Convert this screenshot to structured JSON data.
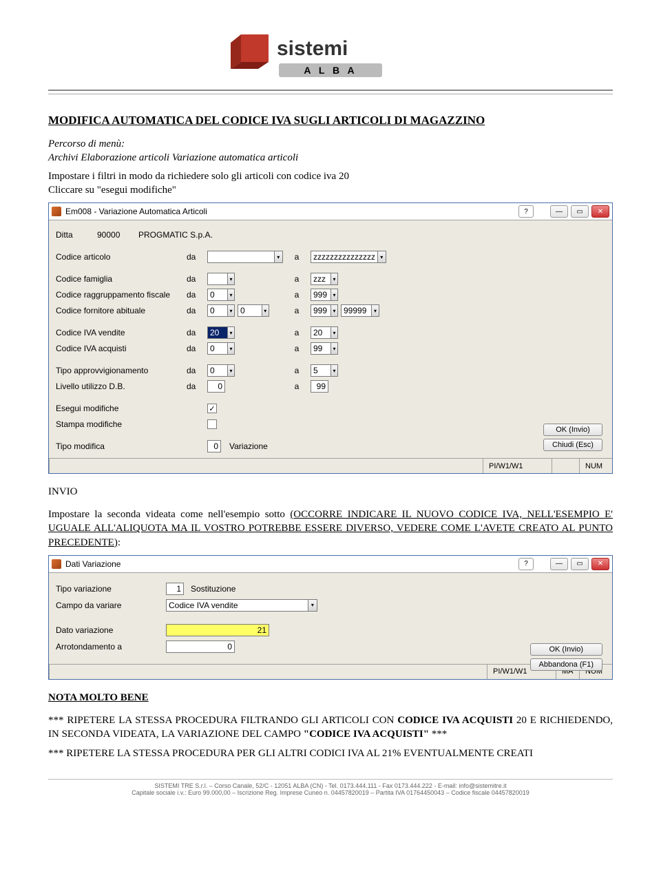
{
  "logo": {
    "brand_top": "sistemi",
    "brand_bottom": "A L B A"
  },
  "title": "MODIFICA AUTOMATICA DEL CODICE IVA SUGLI ARTICOLI DI MAGAZZINO",
  "intro": {
    "percorso_label": "Percorso di menù:",
    "percorso_path": "Archivi Elaborazione articoli Variazione automatica articoli",
    "step1": "Impostare i filtri in modo da richiedere solo gli articoli con codice iva 20",
    "step2": "Cliccare su \"esegui modifiche\""
  },
  "win1": {
    "title": "Em008 - Variazione Automatica Articoli",
    "ditta_label": "Ditta",
    "ditta_code": "90000",
    "ditta_name": "PROGMATIC S.p.A.",
    "rows": {
      "articolo": {
        "label": "Codice articolo",
        "da": "",
        "a": "zzzzzzzzzzzzzzz"
      },
      "famiglia": {
        "label": "Codice famiglia",
        "da": "",
        "a": "zzz"
      },
      "ragg_fiscale": {
        "label": "Codice raggruppamento fiscale",
        "da": "0",
        "a": "999"
      },
      "fornitore": {
        "label": "Codice fornitore abituale",
        "da": "0",
        "da2": "0",
        "a": "999",
        "a2": "99999"
      },
      "iva_vendite": {
        "label": "Codice IVA vendite",
        "da": "20",
        "a": "20"
      },
      "iva_acquisti": {
        "label": "Codice IVA acquisti",
        "da": "0",
        "a": "99"
      },
      "approvv": {
        "label": "Tipo approvvigionamento",
        "da": "0",
        "a": "5"
      },
      "livello_db": {
        "label": "Livello utilizzo D.B.",
        "da": "0",
        "a": "99"
      }
    },
    "esegui_label": "Esegui modifiche",
    "esegui_checked": "✓",
    "stampa_label": "Stampa modifiche",
    "tipo_mod_label": "Tipo modifica",
    "tipo_mod_code": "0",
    "tipo_mod_text": "Variazione",
    "btn_ok": "OK (Invio)",
    "btn_close": "Chiudi (Esc)",
    "da_label": "da",
    "a_label": "a",
    "status_left": "PI/W1/W1",
    "status_right": "NUM"
  },
  "mid": {
    "invio": "INVIO",
    "para": "Impostare la seconda videata come nell'esempio sotto (OCCORRE INDICARE IL NUOVO CODICE IVA, NELL'ESEMPIO E' UGUALE ALL'ALIQUOTA MA IL VOSTRO POTREBBE ESSERE DIVERSO, VEDERE COME L'AVETE CREATO AL PUNTO PRECEDENTE):"
  },
  "win2": {
    "title": "Dati Variazione",
    "tipo_var_label": "Tipo variazione",
    "tipo_var_code": "1",
    "tipo_var_text": "Sostituzione",
    "campo_label": "Campo da variare",
    "campo_value": "Codice IVA vendite",
    "dato_label": "Dato variazione",
    "dato_value": "21",
    "arrot_label": "Arrotondamento a",
    "arrot_value": "0",
    "btn_ok": "OK (Invio)",
    "btn_abb": "Abbandona (F1)",
    "status_left": "PI/W1/W1",
    "status_mid": "MA",
    "status_right": "NUM"
  },
  "nota": {
    "heading": "NOTA MOLTO BENE",
    "p1_pre": "*** RIPETERE LA STESSA PROCEDURA FILTRANDO GLI ARTICOLI CON ",
    "p1_b1": "CODICE IVA ACQUISTI",
    "p1_mid": " 20 E RICHIEDENDO, IN SECONDA VIDEATA, LA VARIAZIONE DEL CAMPO ",
    "p1_b2": "\"CODICE IVA ACQUISTI\"",
    "p1_post": " ***",
    "p2": "*** RIPETERE LA STESSA PROCEDURA PER GLI ALTRI CODICI IVA AL 21% EVENTUALMENTE CREATI"
  },
  "footer": {
    "l1": "SISTEMI TRE S.r.l. – Corso Canale, 52/C - 12051 ALBA (CN) - Tel. 0173.444.111 - Fax 0173.444.222 - E-mail: info@sistemitre.it",
    "l2": "Capitale sociale i.v.: Euro 99.000,00 – Iscrizione Reg. Imprese Cuneo n. 04457820019 – Partita IVA 01764450043 – Codice fiscale 04457820019"
  }
}
